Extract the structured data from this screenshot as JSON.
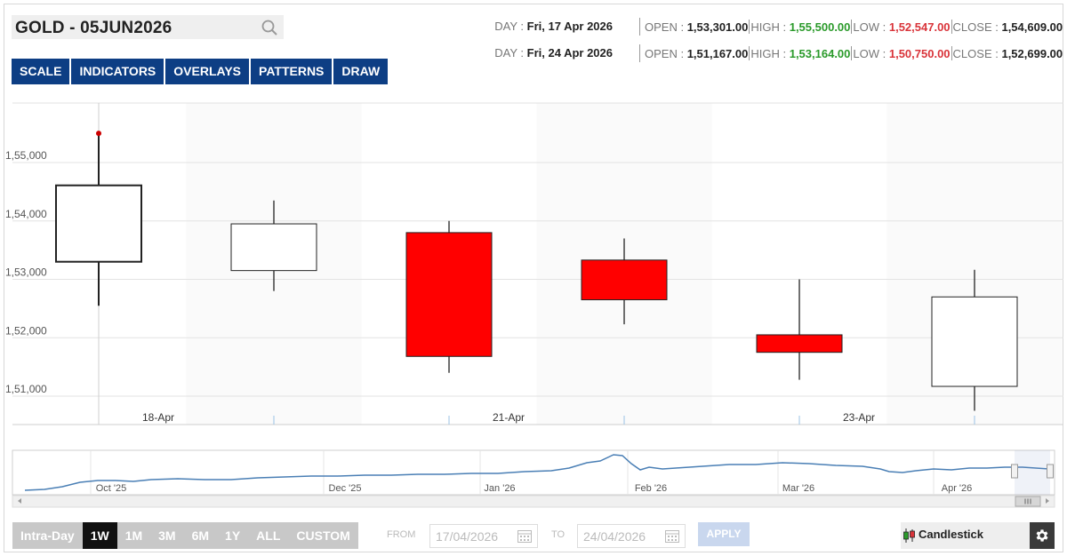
{
  "symbol": {
    "name": "GOLD - 05JUN2026",
    "search_icon": "search-icon"
  },
  "toolbar": {
    "tabs": [
      "SCALE",
      "INDICATORS",
      "OVERLAYS",
      "PATTERNS",
      "DRAW"
    ]
  },
  "ohlc": [
    {
      "day_label": "DAY : ",
      "day": "Fri, 17 Apr 2026",
      "open_label": "OPEN : ",
      "open": "1,53,301.00",
      "high_label": "HIGH : ",
      "high": "1,55,500.00",
      "low_label": "LOW : ",
      "low": "1,52,547.00",
      "close_label": "CLOSE : ",
      "close": "1,54,609.00"
    },
    {
      "day_label": "DAY : ",
      "day": "Fri, 24 Apr 2026",
      "open_label": "OPEN : ",
      "open": "1,51,167.00",
      "high_label": "HIGH : ",
      "high": "1,53,164.00",
      "low_label": "LOW : ",
      "low": "1,50,750.00",
      "close_label": "CLOSE : ",
      "close": "1,52,699.00"
    }
  ],
  "chart_data": {
    "type": "candlestick",
    "categories": [
      "18-Apr",
      "",
      "21-Apr",
      "",
      "23-Apr",
      ""
    ],
    "x_tick_labels": [
      "18-Apr",
      "21-Apr",
      "23-Apr"
    ],
    "y_tick_labels": [
      "1,51,000",
      "1,52,000",
      "1,53,000",
      "1,54,000",
      "1,55,000"
    ],
    "ylim": [
      150500,
      156000
    ],
    "candles": [
      {
        "open": 153301,
        "high": 155500,
        "low": 152547,
        "close": 154609,
        "direction": "up"
      },
      {
        "open": 153150,
        "high": 154350,
        "low": 152800,
        "close": 153950,
        "direction": "up"
      },
      {
        "open": 153800,
        "high": 154000,
        "low": 151400,
        "close": 151680,
        "direction": "down"
      },
      {
        "open": 153330,
        "high": 153700,
        "low": 152230,
        "close": 152650,
        "direction": "down"
      },
      {
        "open": 152050,
        "high": 153000,
        "low": 151280,
        "close": 151750,
        "direction": "down"
      },
      {
        "open": 151167,
        "high": 153164,
        "low": 150750,
        "close": 152699,
        "direction": "up"
      }
    ],
    "high_marker_index": 0,
    "colors": {
      "up": "#ffffff",
      "down": "#ff0000",
      "outline": "#222222",
      "grid": "#e3e3e3",
      "marker": "#cc0000"
    }
  },
  "navigator": {
    "month_labels": [
      "Oct '25",
      "Dec '25",
      "Jan '26",
      "Feb '26",
      "Mar '26",
      "Apr '26"
    ],
    "line_color": "#4a7fb5",
    "scrollbar_icon": "scroll-grip-icon"
  },
  "range": {
    "buttons": [
      "Intra-Day",
      "1W",
      "1M",
      "3M",
      "6M",
      "1Y",
      "ALL",
      "CUSTOM"
    ],
    "active": "1W"
  },
  "dates": {
    "from_label": "FROM",
    "from_placeholder": "17/04/2026",
    "to_label": "TO",
    "to_placeholder": "24/04/2026",
    "apply": "APPLY"
  },
  "chart_type": {
    "label": "Candlestick",
    "icon": "candlestick-icon",
    "settings_icon": "gear-icon"
  }
}
